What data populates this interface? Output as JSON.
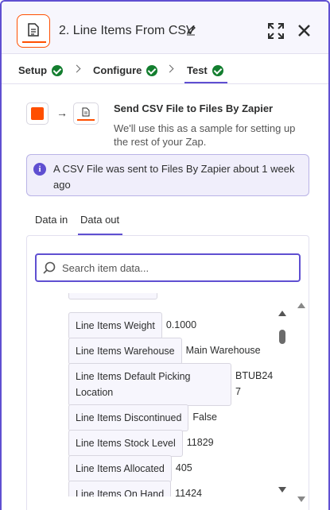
{
  "header": {
    "step_title": "2. Line Items From CSV",
    "icons": [
      "document-icon",
      "pencil-icon",
      "expand-icon",
      "close-icon"
    ]
  },
  "steps": [
    {
      "label": "Setup",
      "status": "complete"
    },
    {
      "label": "Configure",
      "status": "complete"
    },
    {
      "label": "Test",
      "status": "complete",
      "active": true
    }
  ],
  "send": {
    "title": "Send CSV File to Files By Zapier",
    "subtitle": "We'll use this as a sample for setting up the rest of your Zap."
  },
  "banner": {
    "icon": "i",
    "text": "A CSV File was sent to Files By Zapier about 1 week ago"
  },
  "data_tabs": [
    {
      "label": "Data in",
      "active": false
    },
    {
      "label": "Data out",
      "active": true
    }
  ],
  "search": {
    "placeholder": "Search item data...",
    "value": ""
  },
  "items": [
    {
      "key": "Line Items Weight",
      "value": "0.1000"
    },
    {
      "key": "Line Items Warehouse",
      "value": "Main Warehouse"
    },
    {
      "key_line1": "Line Items Default Picking",
      "key_line2": "Location",
      "value_line1": "BTUB24",
      "value_line2": "7"
    },
    {
      "key": "Line Items Discontinued",
      "value": "False"
    },
    {
      "key": "Line Items Stock Level",
      "value": "11829"
    },
    {
      "key": "Line Items Allocated",
      "value": "405"
    },
    {
      "key": "Line Items On Hand",
      "value": "11424"
    }
  ],
  "colors": {
    "accent": "#5f4fd1",
    "brand": "#ff4f00",
    "success": "#137e2f"
  }
}
